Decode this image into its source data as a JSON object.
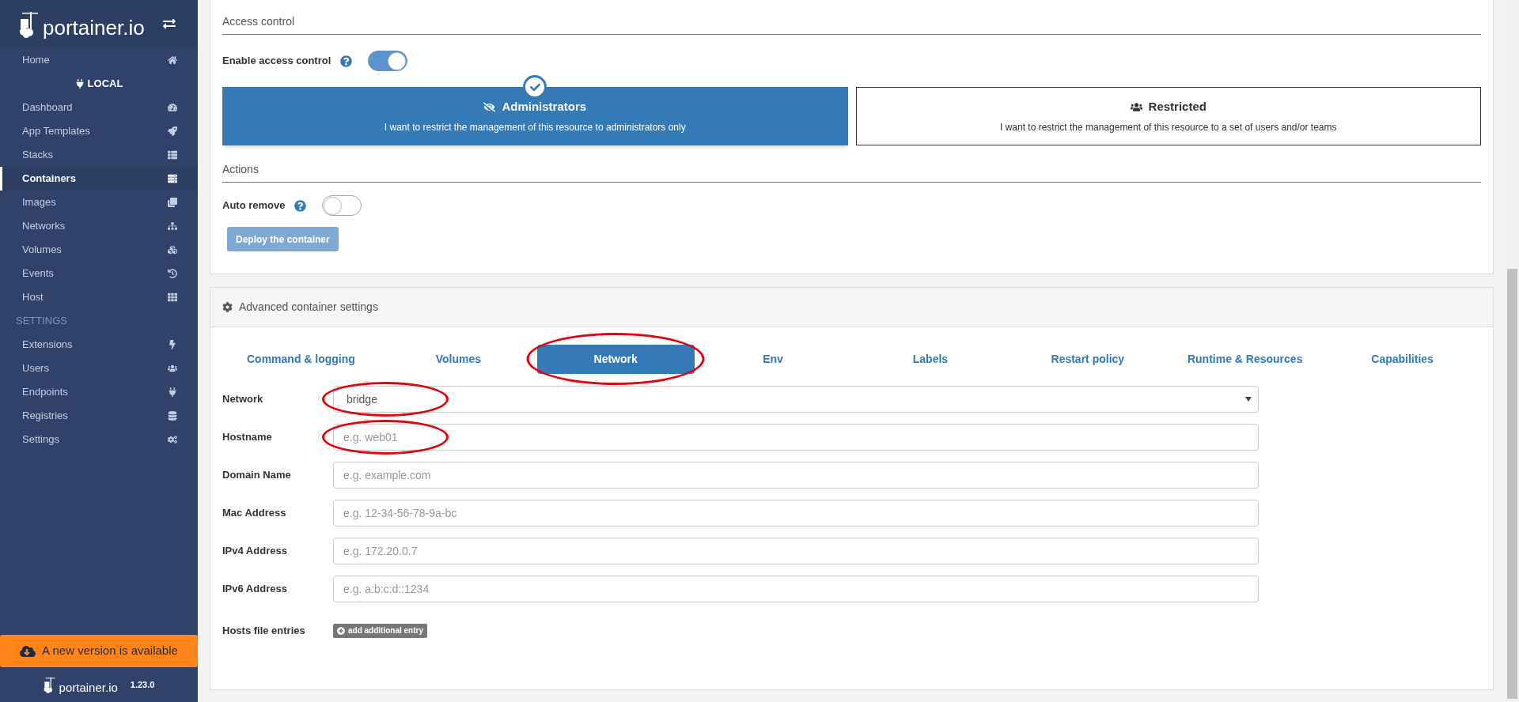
{
  "sidebar": {
    "brand": "portainer.io",
    "home": {
      "label": "Home",
      "selected": false
    },
    "endpoint": "LOCAL",
    "items": [
      {
        "label": "Dashboard",
        "selected": false
      },
      {
        "label": "App Templates",
        "selected": false
      },
      {
        "label": "Stacks",
        "selected": false
      },
      {
        "label": "Containers",
        "selected": true
      },
      {
        "label": "Images",
        "selected": false
      },
      {
        "label": "Networks",
        "selected": false
      },
      {
        "label": "Volumes",
        "selected": false
      },
      {
        "label": "Events",
        "selected": false
      },
      {
        "label": "Host",
        "selected": false
      }
    ],
    "settings_heading": "SETTINGS",
    "settings_items": [
      {
        "label": "Extensions",
        "selected": false
      },
      {
        "label": "Users",
        "selected": false
      },
      {
        "label": "Endpoints",
        "selected": false
      },
      {
        "label": "Registries",
        "selected": false
      },
      {
        "label": "Settings",
        "selected": false
      }
    ],
    "update_banner": "A new version is available",
    "footer": {
      "brand": "portainer.io",
      "version": "1.23.0"
    }
  },
  "access_control": {
    "heading": "Access control",
    "enable_label": "Enable access control",
    "enabled": true,
    "options": [
      {
        "title": "Administrators",
        "description": "I want to restrict the management of this resource to administrators only",
        "selected": true
      },
      {
        "title": "Restricted",
        "description": "I want to restrict the management of this resource to a set of users and/or teams",
        "selected": false
      }
    ]
  },
  "actions": {
    "heading": "Actions",
    "auto_remove_label": "Auto remove",
    "auto_remove": false,
    "deploy_button": "Deploy the container",
    "deploy_disabled": true
  },
  "advanced": {
    "title": "Advanced container settings",
    "tabs": [
      {
        "label": "Command & logging",
        "selected": false,
        "circled": false
      },
      {
        "label": "Volumes",
        "selected": false,
        "circled": false
      },
      {
        "label": "Network",
        "selected": true,
        "circled": true
      },
      {
        "label": "Env",
        "selected": false,
        "circled": false
      },
      {
        "label": "Labels",
        "selected": false,
        "circled": false
      },
      {
        "label": "Restart policy",
        "selected": false,
        "circled": false
      },
      {
        "label": "Runtime & Resources",
        "selected": false,
        "circled": false
      },
      {
        "label": "Capabilities",
        "selected": false,
        "circled": false
      }
    ],
    "fields": [
      {
        "kind": "select",
        "label": "Network",
        "value": "bridge",
        "circled": true
      },
      {
        "kind": "input",
        "label": "Hostname",
        "placeholder": "e.g. web01",
        "circled": true
      },
      {
        "kind": "input",
        "label": "Domain Name",
        "placeholder": "e.g. example.com",
        "circled": false
      },
      {
        "kind": "input",
        "label": "Mac Address",
        "placeholder": "e.g. 12-34-56-78-9a-bc",
        "circled": false
      },
      {
        "kind": "input",
        "label": "IPv4 Address",
        "placeholder": "e.g. 172.20.0.7",
        "circled": false
      },
      {
        "kind": "input",
        "label": "IPv6 Address",
        "placeholder": "e.g. a:b:c:d::1234",
        "circled": false
      }
    ],
    "hosts_label": "Hosts file entries",
    "add_entry_button": "add additional entry"
  }
}
